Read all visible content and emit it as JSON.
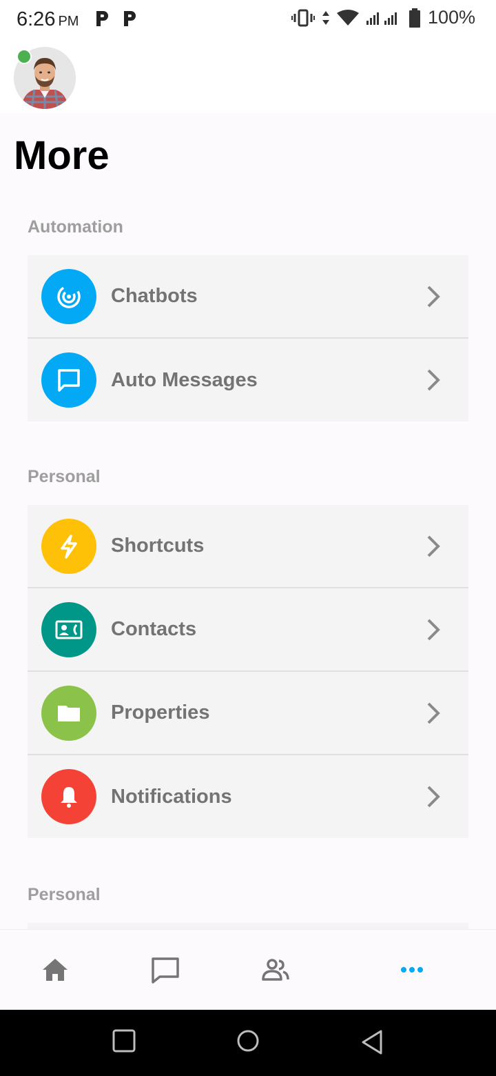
{
  "status_bar": {
    "time": "6:26",
    "ampm": "PM",
    "battery": "100%"
  },
  "header": {
    "title": "More"
  },
  "sections": [
    {
      "label": "Automation",
      "items": [
        {
          "label": "Chatbots",
          "icon": "chatbot-icon",
          "color": "#03a9f4"
        },
        {
          "label": "Auto Messages",
          "icon": "message-icon",
          "color": "#03a9f4"
        }
      ]
    },
    {
      "label": "Personal",
      "items": [
        {
          "label": "Shortcuts",
          "icon": "lightning-icon",
          "color": "#ffc107"
        },
        {
          "label": "Contacts",
          "icon": "contact-card-icon",
          "color": "#009688"
        },
        {
          "label": "Properties",
          "icon": "folder-icon",
          "color": "#8bc34a"
        },
        {
          "label": "Notifications",
          "icon": "bell-icon",
          "color": "#f44336"
        }
      ]
    },
    {
      "label": "Personal",
      "items": []
    }
  ],
  "bottom_nav": {
    "items": [
      {
        "name": "home",
        "icon": "home-icon"
      },
      {
        "name": "messages",
        "icon": "chat-icon"
      },
      {
        "name": "people",
        "icon": "people-icon"
      },
      {
        "name": "more",
        "icon": "more-dots-icon",
        "active": true
      }
    ],
    "active_color": "#03a9f4",
    "inactive_color": "#757575"
  }
}
